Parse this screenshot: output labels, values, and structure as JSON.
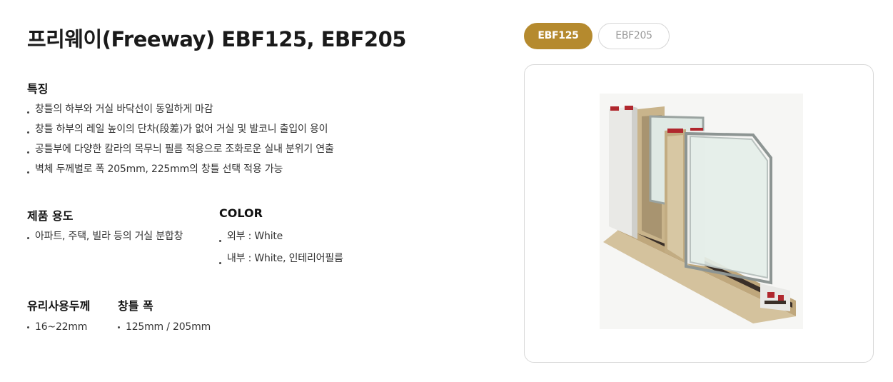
{
  "product": {
    "title": "프리웨이(Freeway) EBF125, EBF205"
  },
  "tabs": [
    {
      "label": "EBF125",
      "active": true
    },
    {
      "label": "EBF205",
      "active": false
    }
  ],
  "features": {
    "heading": "특징",
    "items": [
      "창틀의 하부와 거실 바닥선이 동일하게 마감",
      "창틀 하부의 레일 높이의 단차(段差)가 없어 거실 및 발코니 출입이 용이",
      "공틀부에 다양한 칼라의 목무늬 필름 적용으로 조화로운 실내 분위기 연출",
      "벽체 두께별로 폭 205mm, 225mm의 창틀 선택 적용 가능"
    ]
  },
  "usage": {
    "heading": "제품 용도",
    "items": [
      "아파트, 주택, 빌라 등의 거실 분합창"
    ]
  },
  "color": {
    "heading": "COLOR",
    "items": [
      "외부 : White",
      "내부 : White, 인테리어필름"
    ]
  },
  "glass": {
    "heading": "유리사용두께",
    "items": [
      "16~22mm"
    ]
  },
  "frame_width": {
    "heading": "창틀 폭",
    "items": [
      "125mm / 205mm"
    ]
  },
  "colors": {
    "accent": "#b58a2e",
    "wood": "#c9b48b",
    "frame_red": "#b0282e"
  }
}
